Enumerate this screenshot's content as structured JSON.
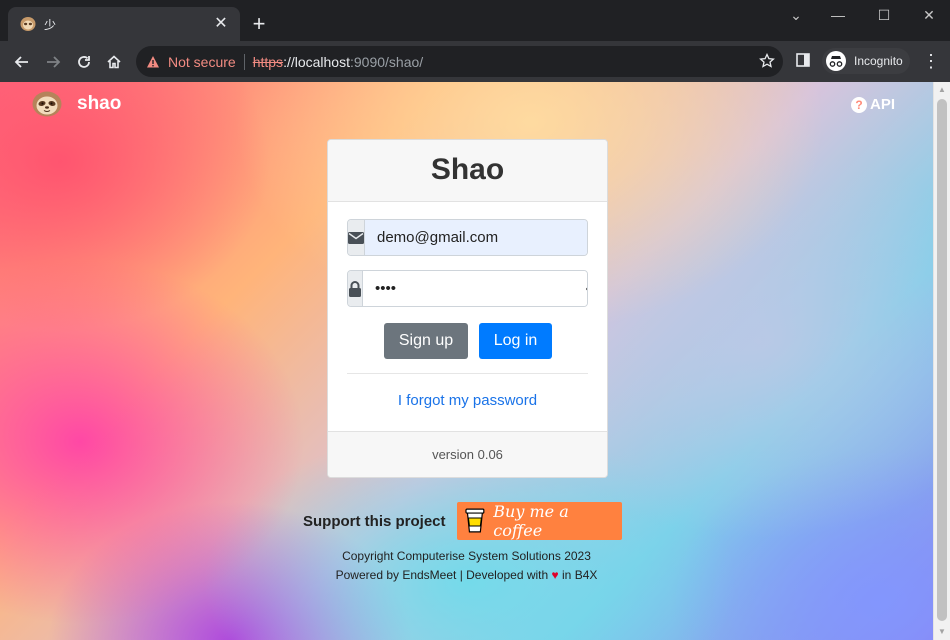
{
  "browser": {
    "tab_title": "少",
    "not_secure_label": "Not secure",
    "url_scheme": "https",
    "url_host": "://localhost",
    "url_rest": ":9090/shao/",
    "profile_label": "Incognito"
  },
  "app": {
    "brand_name": "shao",
    "api_label": "API"
  },
  "login": {
    "title": "Shao",
    "email_value": "demo@gmail.com",
    "password_value": "••••",
    "signup_label": "Sign up",
    "login_label": "Log in",
    "forgot_label": "I forgot my password",
    "version": "version 0.06"
  },
  "footer": {
    "support_label": "Support this project",
    "bmc_label": "Buy me a coffee",
    "copyright": "Copyright Computerise System Solutions 2023",
    "powered_prefix": "Powered by EndsMeet | Developed with",
    "powered_heart": "♥",
    "powered_suffix": "in B4X"
  },
  "colors": {
    "primary": "#007bff",
    "secondary": "#6c757d",
    "bmc_orange": "#ff813f",
    "warning": "#f28b82"
  }
}
